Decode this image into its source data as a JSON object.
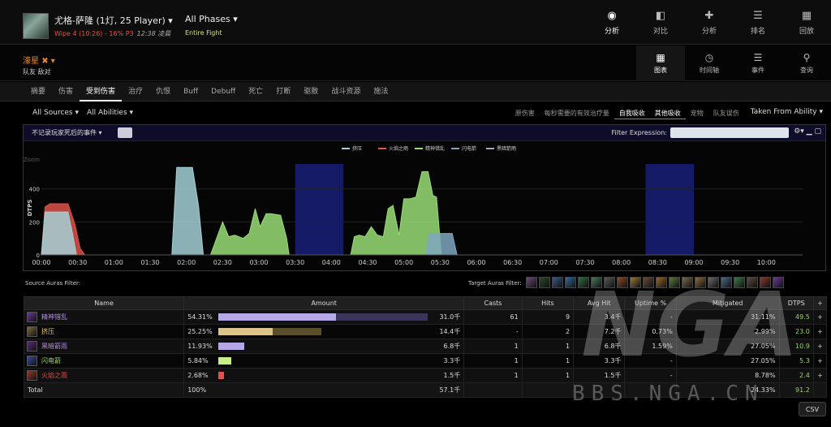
{
  "header": {
    "title": "尤格-萨隆 (1灯, 25 Player)",
    "wipe": "Wipe 4 (10:26) - 16% P3",
    "time": "12:38 凌晨",
    "phases": "All Phases",
    "phase_sub": "Entire Fight",
    "tabs": [
      {
        "label": "分析",
        "icon": "eye-icon",
        "active": true
      },
      {
        "label": "对比",
        "icon": "compare-icon",
        "active": false
      },
      {
        "label": "分析",
        "icon": "puzzle-icon",
        "active": false
      },
      {
        "label": "排名",
        "icon": "rank-icon",
        "active": false
      },
      {
        "label": "回放",
        "icon": "replay-icon",
        "active": false
      }
    ]
  },
  "actor": {
    "name": "濠星",
    "sub": "队友 敌对"
  },
  "view_modes": [
    {
      "label": "图表",
      "icon": "grid-icon",
      "active": true
    },
    {
      "label": "时间轴",
      "icon": "clock-icon",
      "active": false
    },
    {
      "label": "事件",
      "icon": "list-icon",
      "active": false
    },
    {
      "label": "查询",
      "icon": "pin-icon",
      "active": false
    }
  ],
  "view_tabs": [
    "摘要",
    "伤害",
    "受到伤害",
    "治疗",
    "仇恨",
    "Buff",
    "Debuff",
    "死亡",
    "打断",
    "驱散",
    "战斗资源",
    "施法"
  ],
  "active_view_tab": 2,
  "filters": {
    "sources": "All Sources",
    "abilities": "All Abilities",
    "toggles": [
      {
        "label": "原伤害",
        "active": false
      },
      {
        "label": "每秒需要的有效治疗量",
        "active": false
      },
      {
        "label": "自我吸收",
        "active": true
      },
      {
        "label": "其他吸收",
        "active": true
      },
      {
        "label": "宠物",
        "active": false
      },
      {
        "label": "队友误伤",
        "active": false
      }
    ],
    "taken_from": "Taken From Ability"
  },
  "panel": {
    "left_select": "不记录玩家死后的事件",
    "filter_label": "Filter Expression:",
    "filter_value": ""
  },
  "chart_data": {
    "type": "area",
    "ylabel": "DTPS",
    "ylim": [
      0,
      620
    ],
    "y_ticks": [
      "0",
      "200",
      "400",
      "Zoom"
    ],
    "x_ticks": [
      "00:00",
      "00:30",
      "01:00",
      "01:30",
      "02:00",
      "02:30",
      "03:00",
      "03:30",
      "04:00",
      "04:30",
      "05:00",
      "05:30",
      "06:00",
      "06:30",
      "07:00",
      "07:30",
      "08:00",
      "08:30",
      "09:00",
      "09:30",
      "10:00"
    ],
    "xlim_seconds": [
      0,
      630
    ],
    "highlight_ranges_seconds": [
      [
        210,
        250
      ],
      [
        500,
        540
      ]
    ],
    "legend": [
      "挤压",
      "火焰之雨",
      "精神错乱",
      "闪电箭",
      "黑暗箭雨"
    ],
    "series": [
      {
        "name": "火焰之雨",
        "color": "#e0524a",
        "points": [
          [
            0,
            0
          ],
          [
            3,
            290
          ],
          [
            7,
            310
          ],
          [
            22,
            310
          ],
          [
            28,
            180
          ],
          [
            32,
            40
          ],
          [
            36,
            0
          ]
        ]
      },
      {
        "name": "挤压",
        "color": "#a3d0d6",
        "points": [
          [
            0,
            0
          ],
          [
            3,
            260
          ],
          [
            22,
            260
          ],
          [
            26,
            120
          ],
          [
            29,
            0
          ]
        ]
      },
      {
        "name": "挤压",
        "color": "#a3d0d6",
        "points": [
          [
            108,
            0
          ],
          [
            112,
            530
          ],
          [
            125,
            530
          ],
          [
            130,
            300
          ],
          [
            134,
            0
          ]
        ]
      },
      {
        "name": "精神错乱",
        "color": "#99dd77",
        "points": [
          [
            140,
            0
          ],
          [
            145,
            100
          ],
          [
            150,
            200
          ],
          [
            155,
            110
          ],
          [
            160,
            120
          ],
          [
            167,
            100
          ],
          [
            172,
            130
          ],
          [
            177,
            280
          ],
          [
            181,
            170
          ],
          [
            186,
            250
          ],
          [
            190,
            250
          ],
          [
            198,
            240
          ],
          [
            203,
            100
          ],
          [
            205,
            0
          ]
        ]
      },
      {
        "name": "精神错乱",
        "color": "#99dd77",
        "points": [
          [
            256,
            0
          ],
          [
            259,
            110
          ],
          [
            263,
            120
          ],
          [
            268,
            110
          ],
          [
            273,
            170
          ],
          [
            278,
            120
          ],
          [
            283,
            110
          ],
          [
            287,
            280
          ],
          [
            291,
            300
          ],
          [
            296,
            120
          ],
          [
            300,
            340
          ],
          [
            305,
            340
          ],
          [
            310,
            350
          ],
          [
            315,
            505
          ],
          [
            320,
            505
          ],
          [
            324,
            360
          ],
          [
            327,
            350
          ],
          [
            331,
            0
          ]
        ]
      },
      {
        "name": "黑暗箭雨",
        "color": "#7fa7c0",
        "points": [
          [
            318,
            0
          ],
          [
            321,
            130
          ],
          [
            340,
            130
          ],
          [
            344,
            0
          ]
        ]
      }
    ]
  },
  "auras": {
    "source_label": "Source Auras Filter:",
    "target_label": "Target Auras Filter:",
    "target_icons": [
      "#6a4a7a",
      "#2a4a2a",
      "#3a5a8a",
      "#336a9a",
      "#2f6f3f",
      "#4a7a5a",
      "#5a5a5a",
      "#8a4a2a",
      "#9a7a3a",
      "#6a4a3a",
      "#9a6a2a",
      "#5a7a3a",
      "#7a6a4a",
      "#8a6a3a",
      "#6a6a6a",
      "#4a6a8a",
      "#3a7a4a",
      "#5a4a3a",
      "#8a3a2a",
      "#6a3a9a"
    ]
  },
  "table": {
    "headers": [
      "Name",
      "Amount",
      "Casts",
      "Hits",
      "Avg Hit",
      "Uptime %",
      "Mitigated",
      "DTPS"
    ],
    "rows": [
      {
        "name": "精神错乱",
        "color": "#b48ee0",
        "icon": "#6a3a9a",
        "pct": "54.31%",
        "fill": 0.5431,
        "fill2": 0.45,
        "bar": "#b6a8e8",
        "bar2": "#3a335a",
        "amount": "31.0千",
        "casts": "61",
        "hits": "9",
        "avg": "3.4千",
        "uptime": "-",
        "mitigated": "31.11%",
        "dtps": "49.5"
      },
      {
        "name": "挤压",
        "color": "#e8c46a",
        "icon": "#7a6a3a",
        "pct": "25.25%",
        "fill": 0.2525,
        "fill2": 0.24,
        "bar": "#dcc48a",
        "bar2": "#5a4f2a",
        "amount": "14.4千",
        "casts": "-",
        "hits": "2",
        "avg": "7.2千",
        "uptime": "0.73%",
        "mitigated": "2.99%",
        "dtps": "23.0"
      },
      {
        "name": "黑暗箭雨",
        "color": "#b48ee0",
        "icon": "#5a2a7a",
        "pct": "11.93%",
        "fill": 0.1193,
        "fill2": 0,
        "bar": "#b6a8e8",
        "bar2": "#3a335a",
        "amount": "6.8千",
        "casts": "1",
        "hits": "1",
        "avg": "6.8千",
        "uptime": "1.59%",
        "mitigated": "27.05%",
        "dtps": "10.9"
      },
      {
        "name": "闪电箭",
        "color": "#9bd25f",
        "icon": "#3a4a9a",
        "pct": "5.84%",
        "fill": 0.0584,
        "fill2": 0,
        "bar": "#c8ee8a",
        "bar2": "#3a5a2a",
        "amount": "3.3千",
        "casts": "1",
        "hits": "1",
        "avg": "3.3千",
        "uptime": "-",
        "mitigated": "27.05%",
        "dtps": "5.3"
      },
      {
        "name": "火焰之雨",
        "color": "#e0524a",
        "icon": "#9a3a2a",
        "pct": "2.68%",
        "fill": 0.0268,
        "fill2": 0,
        "bar": "#e0524a",
        "bar2": "#5a2a2a",
        "amount": "1.5千",
        "casts": "1",
        "hits": "1",
        "avg": "1.5千",
        "uptime": "-",
        "mitigated": "8.78%",
        "dtps": "2.4"
      }
    ],
    "total": {
      "label": "Total",
      "pct": "100%",
      "amount": "57.1千",
      "mitigated": "24.33%",
      "dtps": "91.2"
    }
  },
  "csv_label": "CSV",
  "watermark": "BBS.NGA.CN"
}
